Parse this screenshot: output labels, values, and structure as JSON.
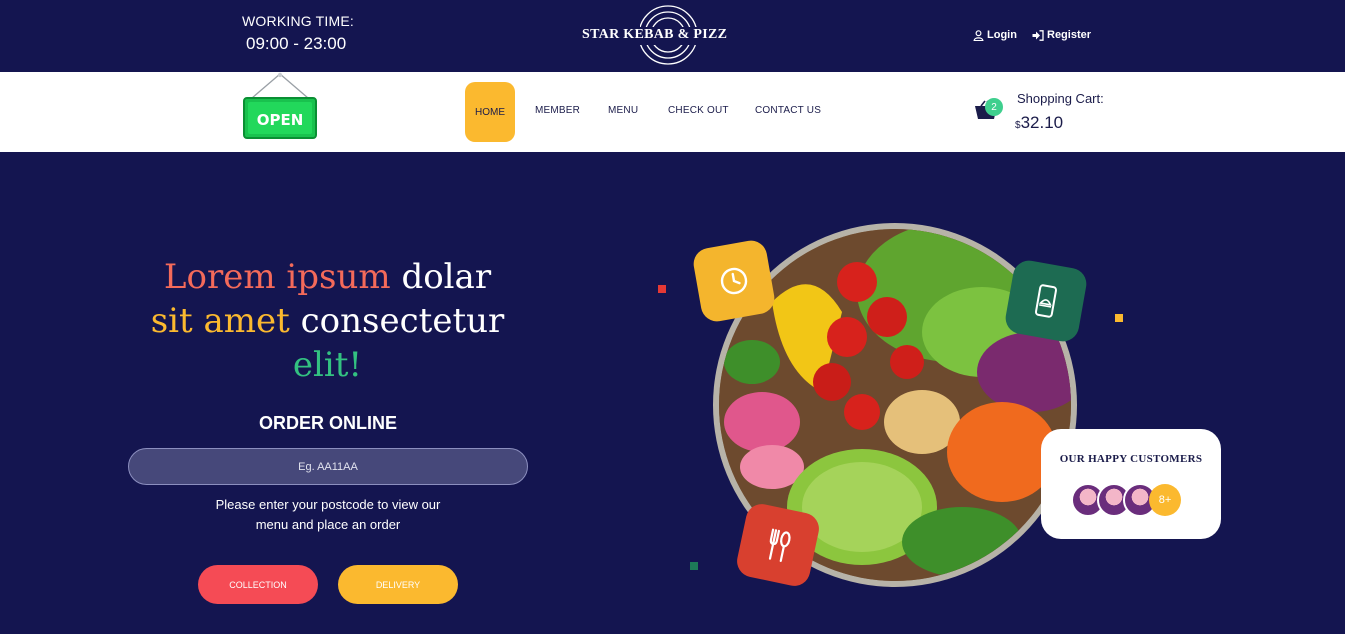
{
  "header": {
    "working_time_label": "WORKING TIME:",
    "working_time_hours": "09:00 - 23:00",
    "brand_name": "STAR KEBAB & PIZZ",
    "login_label": "Login",
    "register_label": "Register"
  },
  "nav": {
    "open_sign": "OPEN",
    "items": [
      {
        "label": "HOME",
        "active": true
      },
      {
        "label": "MEMBER"
      },
      {
        "label": "MENU"
      },
      {
        "label": "CHECK OUT"
      },
      {
        "label": "CONTACT US"
      }
    ],
    "cart": {
      "label": "Shopping Cart:",
      "currency": "$",
      "total": "32.10",
      "count": "2"
    }
  },
  "hero": {
    "headline": {
      "part1": "Lorem ipsum",
      "part2": "dolar",
      "part3": "sit amet",
      "part4": "consectetur",
      "part5": "elit!"
    },
    "order_title": "ORDER ONLINE",
    "postcode_placeholder": "Eg. AA11AA",
    "hint_line1": "Please enter your postcode to view our",
    "hint_line2": "menu and place an order",
    "collection_label": "COLLECTION",
    "delivery_label": "DELIVERY"
  },
  "customers": {
    "title": "OUR HAPPY CUSTOMERS",
    "more_count": "8+"
  },
  "colors": {
    "background": "#141550",
    "accent_yellow": "#fbb92f",
    "accent_red": "#f54b55",
    "accent_coral": "#f46a5a",
    "accent_green": "#33c181"
  },
  "icons": [
    "user-icon",
    "sign-in-icon",
    "cart-icon",
    "clock-icon",
    "phone-order-icon",
    "cutlery-icon"
  ]
}
